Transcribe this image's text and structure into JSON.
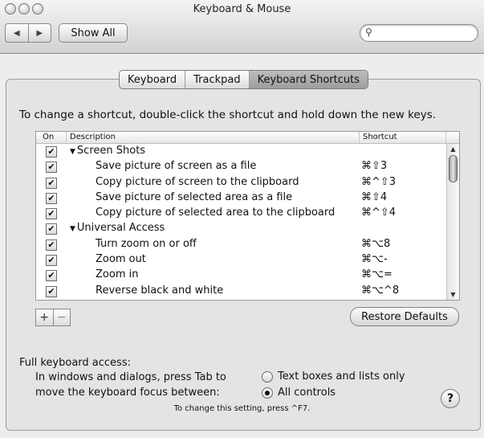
{
  "window": {
    "title": "Keyboard & Mouse",
    "traffic_lights": [
      "close",
      "minimize",
      "zoom"
    ]
  },
  "toolbar": {
    "back_icon": "◀",
    "forward_icon": "▶",
    "show_all_label": "Show All",
    "search_icon": "⚲",
    "search_value": ""
  },
  "tabs": [
    {
      "label": "Keyboard",
      "selected": false
    },
    {
      "label": "Trackpad",
      "selected": false
    },
    {
      "label": "Keyboard Shortcuts",
      "selected": true
    }
  ],
  "instruction": "To change a shortcut, double-click the shortcut and hold down the new keys.",
  "shortcuts_table": {
    "headers": {
      "on": "On",
      "description": "Description",
      "shortcut": "Shortcut"
    },
    "rows": [
      {
        "checked": true,
        "group": true,
        "description": "Screen Shots",
        "shortcut": ""
      },
      {
        "checked": true,
        "group": false,
        "description": "Save picture of screen as a file",
        "shortcut": "⌘⇧3"
      },
      {
        "checked": true,
        "group": false,
        "description": "Copy picture of screen to the clipboard",
        "shortcut": "⌘^⇧3"
      },
      {
        "checked": true,
        "group": false,
        "description": "Save picture of selected area as a file",
        "shortcut": "⌘⇧4"
      },
      {
        "checked": true,
        "group": false,
        "description": "Copy picture of selected area to the clipboard",
        "shortcut": "⌘^⇧4"
      },
      {
        "checked": true,
        "group": true,
        "description": "Universal Access",
        "shortcut": ""
      },
      {
        "checked": true,
        "group": false,
        "description": "Turn zoom on or off",
        "shortcut": "⌘⌥8"
      },
      {
        "checked": true,
        "group": false,
        "description": "Zoom out",
        "shortcut": "⌘⌥-"
      },
      {
        "checked": true,
        "group": false,
        "description": "Zoom in",
        "shortcut": "⌘⌥="
      },
      {
        "checked": true,
        "group": false,
        "description": "Reverse black and white",
        "shortcut": "⌘⌥^8"
      }
    ],
    "checkmark": "✔",
    "disclosure": "▼",
    "scroll_up": "▲",
    "scroll_down": "▼"
  },
  "buttons": {
    "add": "+",
    "remove": "−",
    "restore_defaults": "Restore Defaults",
    "help": "?"
  },
  "full_keyboard_access": {
    "title": "Full keyboard access:",
    "desc_line1": "In windows and dialogs, press Tab to",
    "desc_line2": "move the keyboard focus between:",
    "options": [
      {
        "label": "Text boxes and lists only",
        "selected": false
      },
      {
        "label": "All controls",
        "selected": true
      }
    ],
    "note": "To change this setting, press ^F7."
  }
}
